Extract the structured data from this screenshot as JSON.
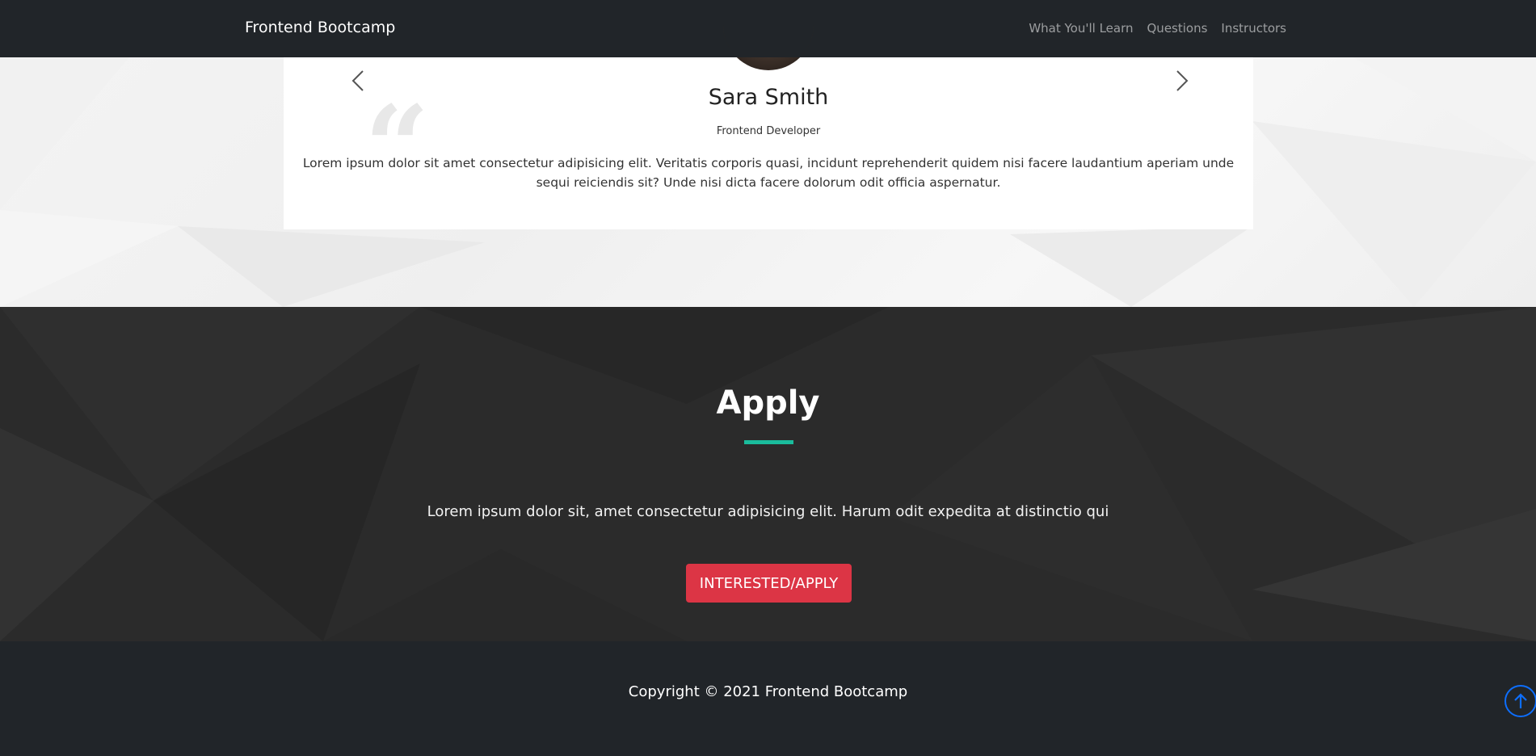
{
  "navbar": {
    "brand": "Frontend Bootcamp",
    "links": [
      "What You'll Learn",
      "Questions",
      "Instructors"
    ]
  },
  "testimonial": {
    "name": "Sara Smith",
    "role": "Frontend Developer",
    "quote": "Lorem ipsum dolor sit amet consectetur adipisicing elit. Veritatis corporis quasi, incidunt reprehenderit quidem nisi facere laudantium aperiam unde sequi reiciendis sit? Unde nisi dicta facere dolorum odit officia aspernatur.",
    "quote_mark": "“"
  },
  "apply": {
    "title": "Apply",
    "text": "Lorem ipsum dolor sit, amet consectetur adipisicing elit. Harum odit expedita at distinctio qui",
    "button_label": "INTERESTED/APPLY"
  },
  "footer": {
    "copyright": "Copyright © 2021 Frontend Bootcamp"
  },
  "colors": {
    "navbar_bg": "#212529",
    "accent_underline": "#1abc9c",
    "apply_button": "#dc3545",
    "scroll_top": "#0d6efd"
  },
  "icons": {
    "prev": "chevron-left-icon",
    "next": "chevron-right-icon",
    "scroll_top": "arrow-up-circle-icon"
  }
}
